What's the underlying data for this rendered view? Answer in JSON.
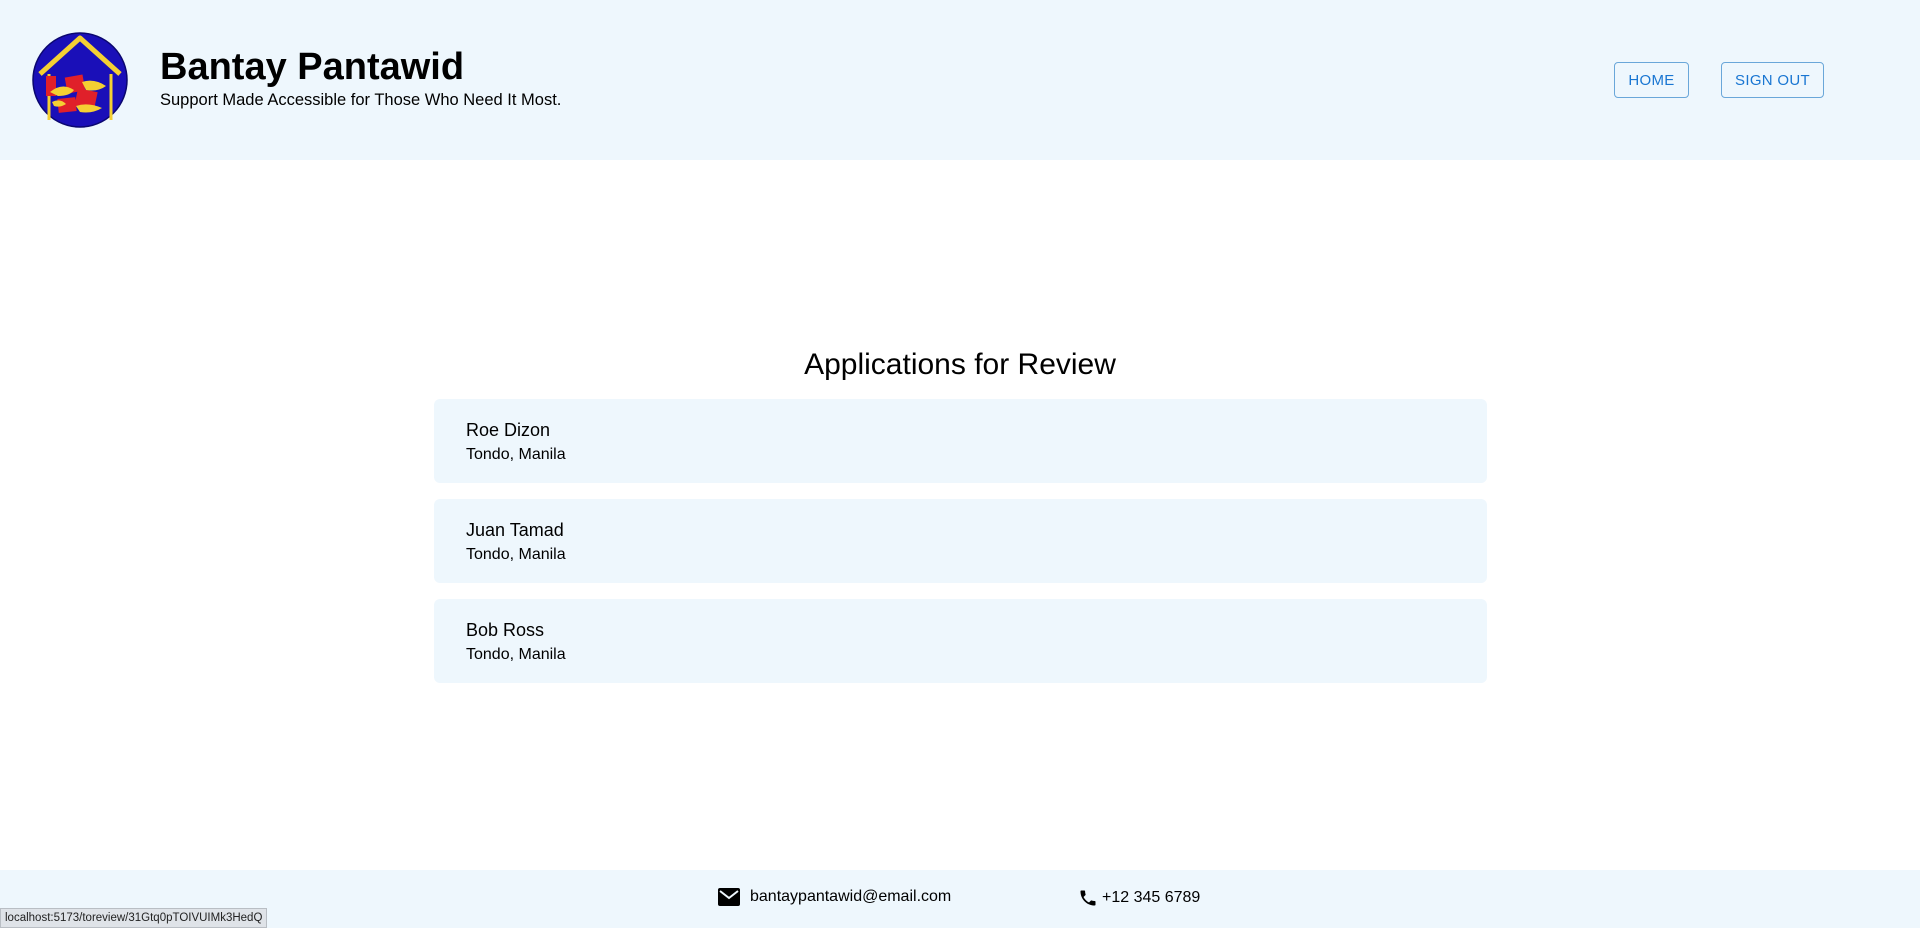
{
  "header": {
    "title": "Bantay Pantawid",
    "tagline": "Support Made Accessible for Those Who Need It Most.",
    "nav": {
      "home_label": "HOME",
      "signout_label": "SIGN OUT"
    },
    "logo_icon": "house-hands-logo-icon"
  },
  "main": {
    "title": "Applications for Review",
    "applications": [
      {
        "name": "Roe Dizon",
        "location": "Tondo, Manila"
      },
      {
        "name": "Juan Tamad",
        "location": "Tondo, Manila"
      },
      {
        "name": "Bob Ross",
        "location": "Tondo, Manila"
      }
    ]
  },
  "footer": {
    "email": "bantaypantawid@email.com",
    "email_icon": "mail-icon",
    "phone": "+12 345 6789",
    "phone_icon": "phone-icon"
  },
  "status_bar": {
    "url": "localhost:5173/toreview/31Gtq0pTOIVUIMk3HedQ"
  },
  "colors": {
    "header_bg": "#eef7fd",
    "accent": "#1976d2",
    "card_bg": "#eef7fd",
    "logo_blue": "#1a0fb8",
    "logo_yellow": "#f5d033",
    "logo_red": "#e0202a"
  }
}
